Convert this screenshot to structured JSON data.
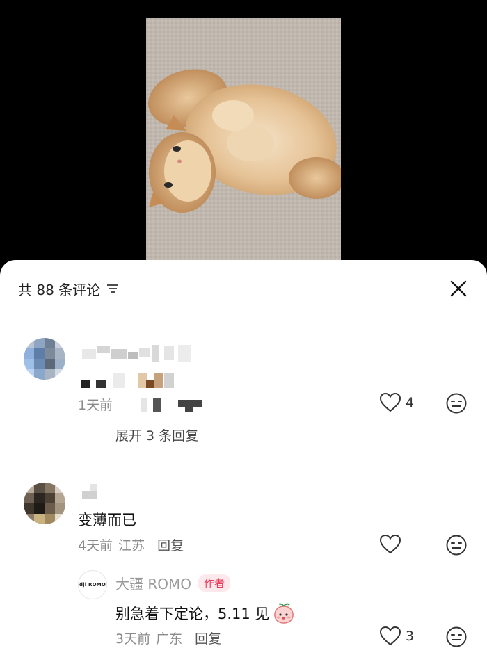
{
  "sheet": {
    "title": "共 88 条评论",
    "sort_icon": "sort-lines-icon",
    "close_icon": "close-x-icon"
  },
  "comments": [
    {
      "avatar": "pixelated-avatar",
      "username": "",
      "text": "",
      "time": "1天前",
      "likes": "4",
      "expand_label": "展开 3 条回复"
    },
    {
      "avatar": "pixelated-avatar",
      "username": "",
      "text": "变薄而已",
      "time": "4天前",
      "location": "江苏",
      "reply_label": "回复",
      "likes": "",
      "replies": [
        {
          "avatar_text": "dji ROMO",
          "username": "大疆 ROMO",
          "badge": "作者",
          "text": "别急着下定论，5.11 见",
          "time": "3天前",
          "location": "广东",
          "reply_label": "回复",
          "likes": "3"
        }
      ]
    }
  ],
  "colors": {
    "accent": "#e83a5b",
    "badge_bg": "#fde8ec",
    "meta": "#8a8a8a",
    "backdrop": "#000000"
  }
}
